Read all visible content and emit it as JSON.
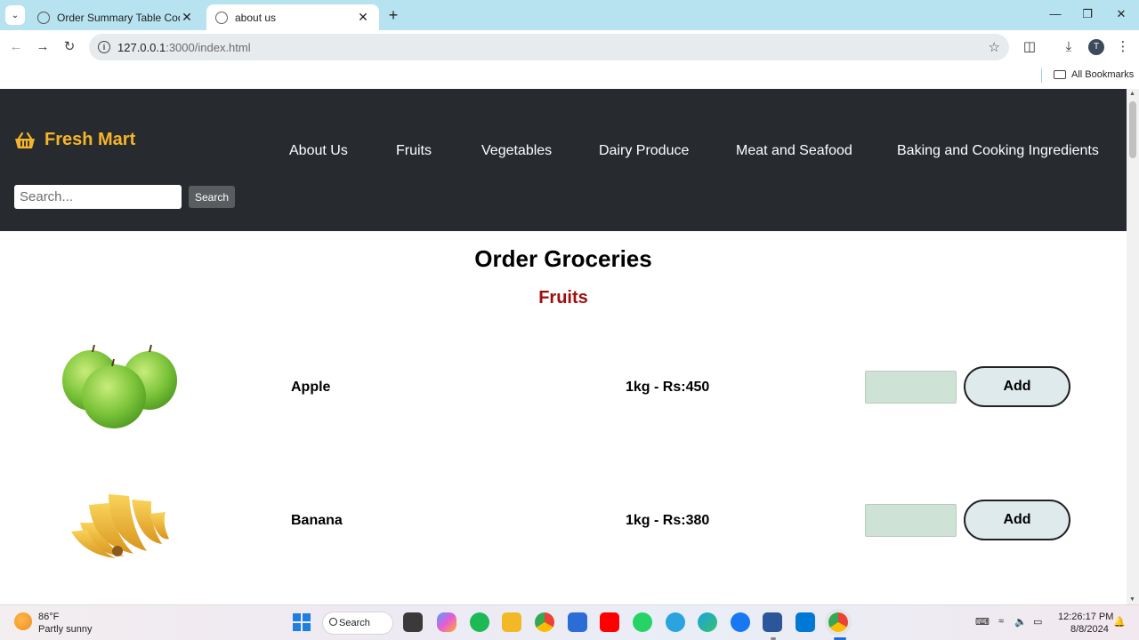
{
  "browser": {
    "tabs": [
      {
        "title": "Order Summary Table Code",
        "active": false
      },
      {
        "title": "about us",
        "active": true
      }
    ],
    "url_host": "127.0.0.1",
    "url_path": ":3000/index.html",
    "bookmarks_label": "All Bookmarks",
    "profile_initial": "T"
  },
  "site": {
    "brand": "Fresh Mart",
    "nav": [
      "About Us",
      "Fruits",
      "Vegetables",
      "Dairy Produce",
      "Meat and Seafood",
      "Baking and Cooking Ingredients"
    ],
    "search": {
      "placeholder": "Search...",
      "button": "Search"
    },
    "colors": {
      "header_bg": "#272b2f",
      "brand": "#f5b52a",
      "section_title": "#a00d0d"
    }
  },
  "main": {
    "title": "Order Groceries",
    "section": "Fruits",
    "products": [
      {
        "name": "Apple",
        "price": "1kg - Rs:450",
        "button": "Add",
        "image": "green-apples"
      },
      {
        "name": "Banana",
        "price": "1kg - Rs:380",
        "button": "Add",
        "image": "banana-bunch"
      }
    ]
  },
  "taskbar": {
    "weather_temp": "86°F",
    "weather_desc": "Partly sunny",
    "search_label": "Search",
    "time": "12:26:17 PM",
    "date": "8/8/2024"
  }
}
